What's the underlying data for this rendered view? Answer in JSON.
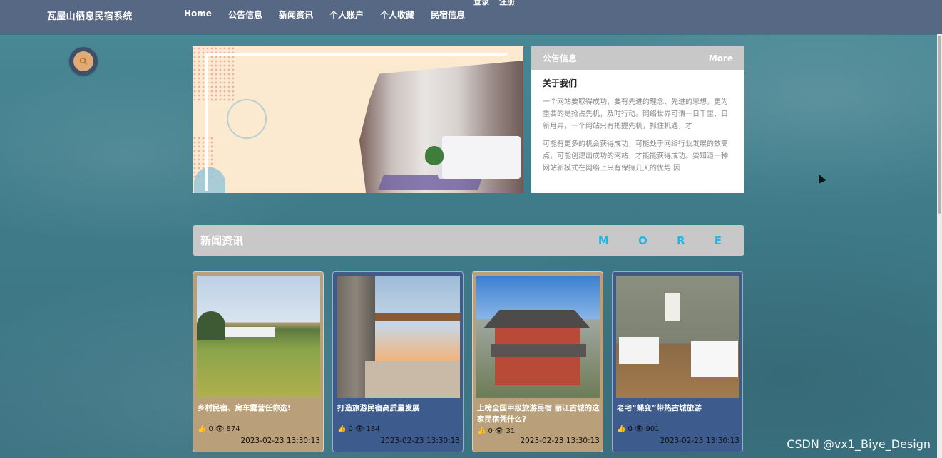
{
  "nav": {
    "brand": "瓦屋山栖息民宿系统",
    "items": [
      "Home",
      "公告信息",
      "新闻资讯",
      "个人账户",
      "个人收藏",
      "民宿信息"
    ],
    "auth": {
      "login": "登录",
      "register": "注册"
    }
  },
  "notice": {
    "header": "公告信息",
    "more": "More",
    "title": "关于我们",
    "paragraphs": [
      "一个网站要取得成功，要有先进的理念、先进的思想，更为重要的是抢占先机，及时行动。网络世界可谓一日千里、日新月异，一个网站只有把握先机，抓住机遇，才",
      "可能有更多的机会获得成功，可能处于网络行业发展的数高点，可能创建出成功的网站，才能能获得成功。要知道一种网站新模式在网络上只有保持几天的优势,因"
    ]
  },
  "news": {
    "title": "新闻资讯",
    "more": "M O R E",
    "cards": [
      {
        "caption": "乡村民宿、房车露营任你选!",
        "likes": "0",
        "views": "874",
        "date": "2023-02-23 13:30:13"
      },
      {
        "caption": "打造旅游民宿高质量发展",
        "likes": "0",
        "views": "184",
        "date": "2023-02-23 13:30:13"
      },
      {
        "caption": "上榜全国甲级旅游民宿 丽江古城的这家民宿凭什么?",
        "likes": "0",
        "views": "31",
        "date": "2023-02-23 13:30:13"
      },
      {
        "caption": "老宅“蝶变”带热古城旅游",
        "likes": "0",
        "views": "901",
        "date": "2023-02-23 13:30:13"
      }
    ]
  },
  "watermark": "CSDN @vx1_Biye_Design",
  "icons": {
    "search": "search-icon",
    "like": "thumb-up-icon",
    "view": "eye-icon"
  },
  "colors": {
    "navbar": "#566884",
    "moreAccent": "#1fb6e6",
    "cardTan": "#b9a07a",
    "cardBlue": "#3d5b8c"
  }
}
